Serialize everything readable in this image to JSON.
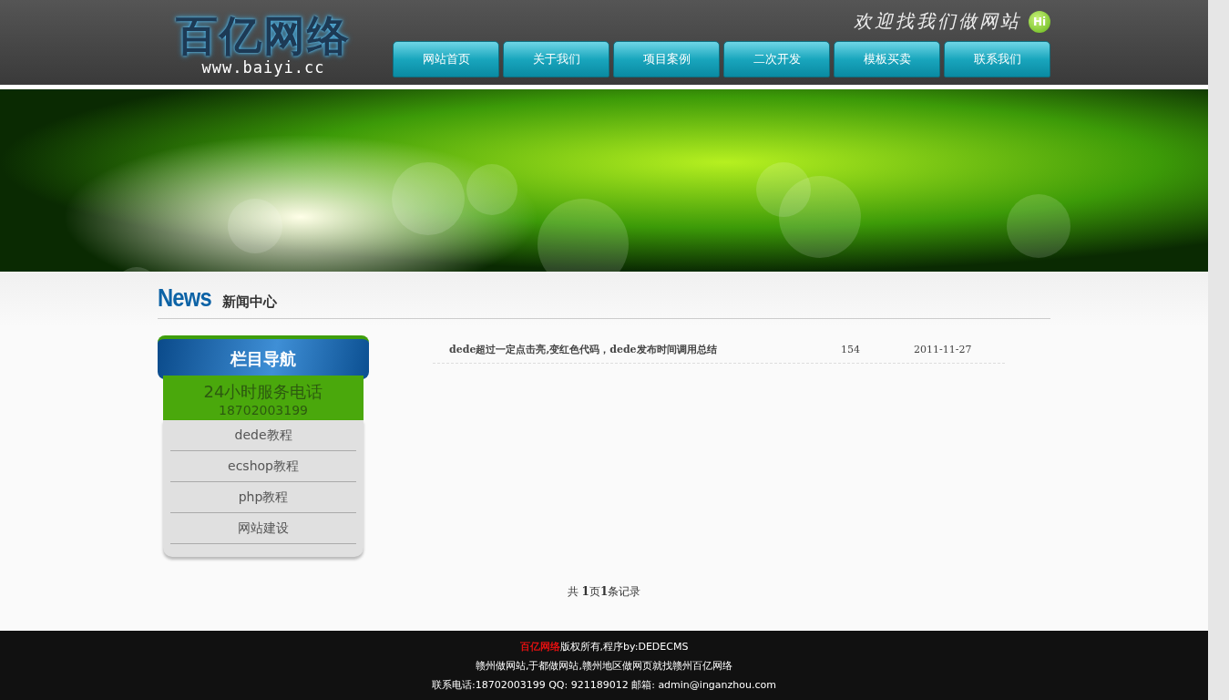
{
  "header": {
    "logo": {
      "name": "百亿网络",
      "url": "www.baiyi.cc"
    },
    "slogan": "欢迎找我们做网站",
    "badge": "Hi",
    "nav": [
      {
        "label": "网站首页"
      },
      {
        "label": "关于我们"
      },
      {
        "label": "项目案例"
      },
      {
        "label": "二次开发"
      },
      {
        "label": "模板买卖"
      },
      {
        "label": "联系我们"
      }
    ]
  },
  "section": {
    "title_en": "News",
    "title": "新闻中心"
  },
  "sidebar": {
    "heading": "栏目导航",
    "hotline": {
      "label": "24小时服务电话",
      "phone": "18702003199"
    },
    "items": [
      {
        "label": "dede教程"
      },
      {
        "label": "ecshop教程"
      },
      {
        "label": "php教程"
      },
      {
        "label": "网站建设"
      }
    ]
  },
  "articles": [
    {
      "title": "dede超过一定点击亮,变红色代码，dede发布时间调用总结",
      "hits": "154",
      "date": "2011-11-27"
    }
  ],
  "pagination": "共 **1**页**1**条记录",
  "footer": {
    "brand": "百亿网络",
    "copyright": "版权所有,程序by:DEDECMS",
    "lines": [
      "赣州做网站,于都做网站,赣州地区做网页就找赣州百亿网络",
      "联系电话:18702003199 QQ: 921189012 邮箱: admin@inganzhou.com"
    ]
  }
}
